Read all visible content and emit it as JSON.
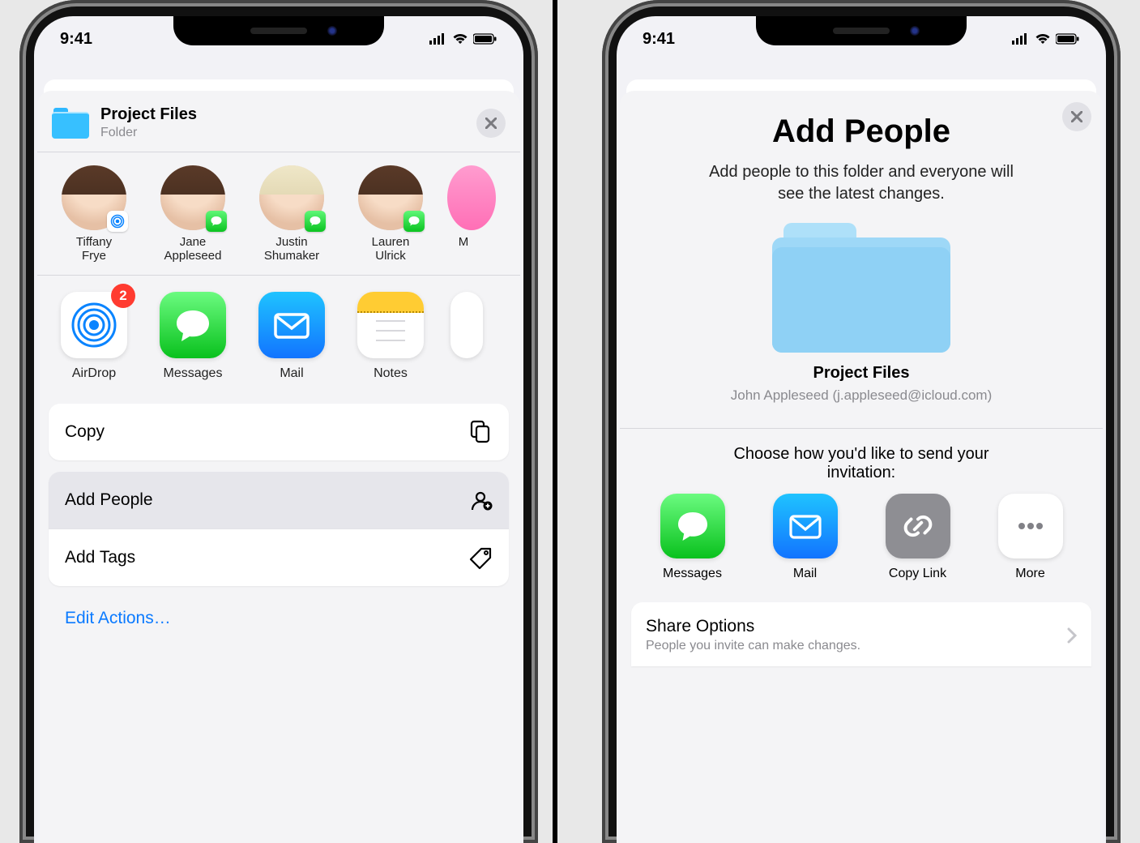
{
  "status": {
    "time": "9:41"
  },
  "share_sheet": {
    "item_title": "Project Files",
    "item_subtitle": "Folder",
    "contacts": [
      {
        "first": "Tiffany",
        "last": "Frye",
        "badge": "airdrop"
      },
      {
        "first": "Jane",
        "last": "Appleseed",
        "badge": "messages"
      },
      {
        "first": "Justin",
        "last": "Shumaker",
        "badge": "messages",
        "blond": true
      },
      {
        "first": "Lauren",
        "last": "Ulrick",
        "badge": "messages"
      },
      {
        "first": "M",
        "partial": true,
        "pink": true
      }
    ],
    "apps": [
      {
        "name": "AirDrop",
        "badge": "2"
      },
      {
        "name": "Messages"
      },
      {
        "name": "Mail"
      },
      {
        "name": "Notes"
      }
    ],
    "actions": {
      "copy": "Copy",
      "add_people": "Add People",
      "add_tags": "Add Tags",
      "edit": "Edit Actions…"
    }
  },
  "add_people": {
    "title": "Add People",
    "description_l1": "Add people to this folder and everyone will",
    "description_l2": "see the latest changes.",
    "folder_name": "Project Files",
    "owner": "John Appleseed (j.appleseed@icloud.com)",
    "choose_l1": "Choose how you'd like to send your",
    "choose_l2": "invitation:",
    "invites": [
      {
        "name": "Messages"
      },
      {
        "name": "Mail"
      },
      {
        "name": "Copy Link"
      },
      {
        "name": "More"
      }
    ],
    "share_options_title": "Share Options",
    "share_options_sub": "People you invite can make changes."
  }
}
